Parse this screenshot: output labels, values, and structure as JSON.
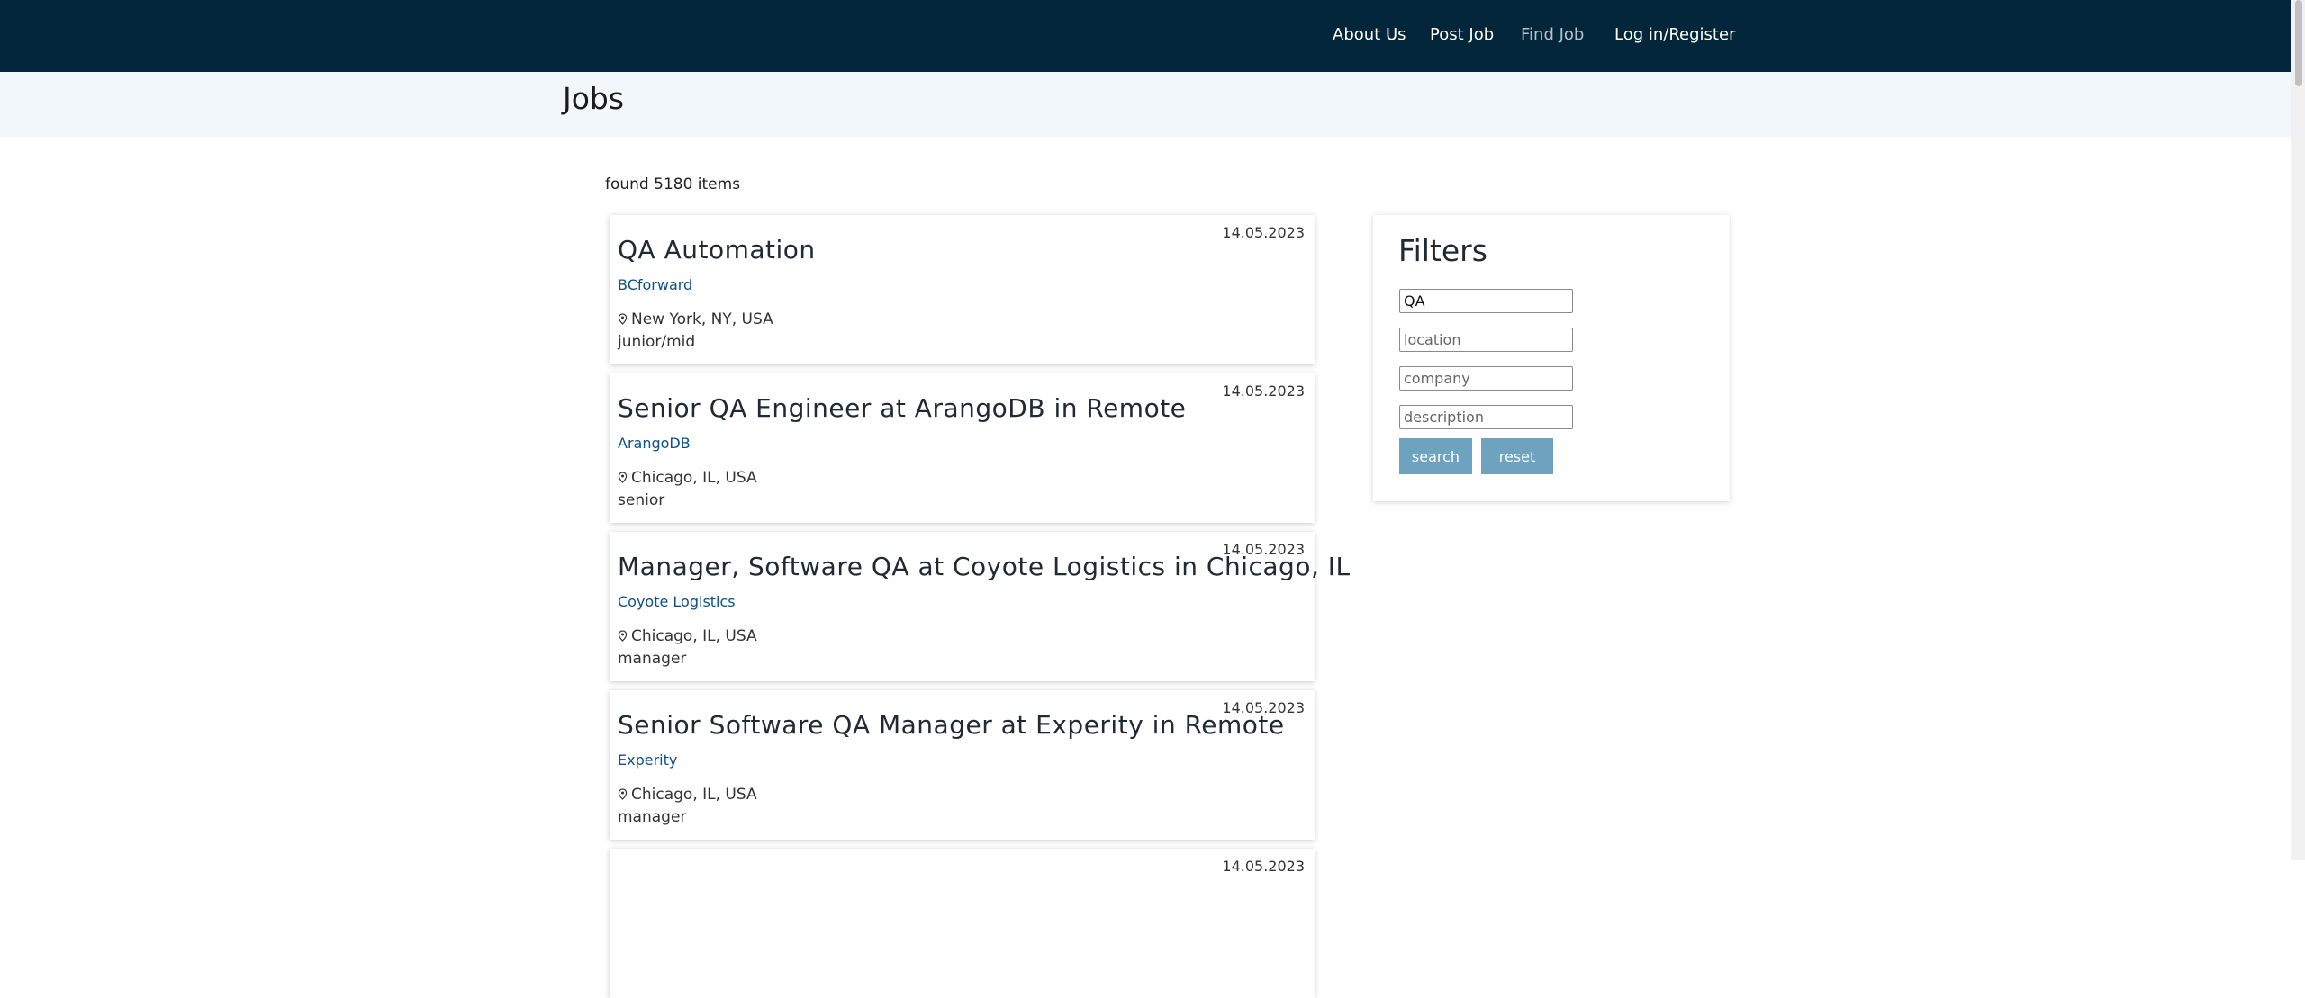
{
  "nav": {
    "about": "About Us",
    "post": "Post Job",
    "find": "Find Job",
    "login": "Log in/Register"
  },
  "page_title": "Jobs",
  "found_text": "found 5180 items",
  "jobs": [
    {
      "title": "QA Automation",
      "company": "BCforward",
      "location": "New York, NY, USA",
      "level": "junior/mid",
      "date": "14.05.2023"
    },
    {
      "title": "Senior QA Engineer at ArangoDB in Remote",
      "company": "ArangoDB",
      "location": "Chicago, IL, USA",
      "level": "senior",
      "date": "14.05.2023"
    },
    {
      "title": "Manager, Software QA at Coyote Logistics in Chicago, IL",
      "company": "Coyote Logistics",
      "location": "Chicago, IL, USA",
      "level": "manager",
      "date": "14.05.2023"
    },
    {
      "title": "Senior Software QA Manager at Experity in Remote",
      "company": "Experity",
      "location": "Chicago, IL, USA",
      "level": "manager",
      "date": "14.05.2023"
    },
    {
      "title": "",
      "company": "",
      "location": "",
      "level": "",
      "date": "14.05.2023"
    }
  ],
  "filters": {
    "title": "Filters",
    "title_value": "QA",
    "location_placeholder": "location",
    "company_placeholder": "company",
    "description_placeholder": "description",
    "search_label": "search",
    "reset_label": "reset"
  },
  "icons": {
    "location": "map-pin-icon"
  },
  "colors": {
    "nav_bg": "#03263b",
    "band_bg": "#f1f7fa",
    "button": "#6ea3c0",
    "company_link": "#0c4f8c"
  }
}
